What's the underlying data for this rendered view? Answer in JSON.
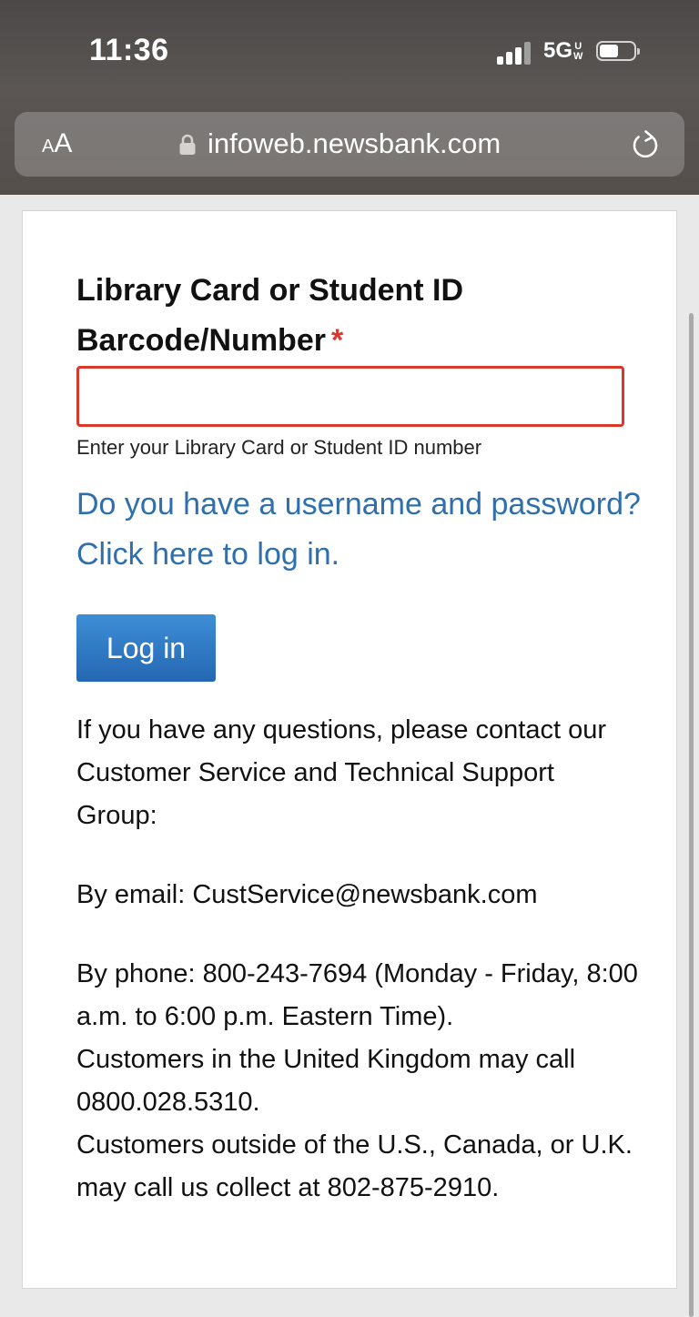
{
  "status_bar": {
    "time": "11:36",
    "network": "5G",
    "network_suffix_top": "U",
    "network_suffix_bottom": "W",
    "battery_level": 0.55
  },
  "browser": {
    "text_size_button": "AA",
    "url": "infoweb.newsbank.com",
    "icons": [
      "lock-icon",
      "reload-icon"
    ]
  },
  "form": {
    "label_line1": "Library Card or Student ID",
    "label_line2": "Barcode/Number",
    "required_marker": "*",
    "card_value": "",
    "hint": "Enter your Library Card or Student ID number",
    "alt_login_link": "Do you have a username and password? Click here to log in.",
    "login_button": "Log in"
  },
  "support": {
    "intro": "If you have any questions, please contact our Customer Service and Technical Support Group:",
    "email": "By email: CustService@newsbank.com",
    "phone_1": "By phone: 800-243-7694 (Monday - Friday, 8:00 a.m. to 6:00 p.m. Eastern Time).",
    "phone_2": "Customers in the United Kingdom may call 0800.028.5310.",
    "phone_3": "Customers outside of the U.S., Canada, or U.K. may call us collect at 802-875-2910."
  },
  "colors": {
    "link": "#2f6fad",
    "required": "#d9392b",
    "button": "#2e77c4"
  }
}
